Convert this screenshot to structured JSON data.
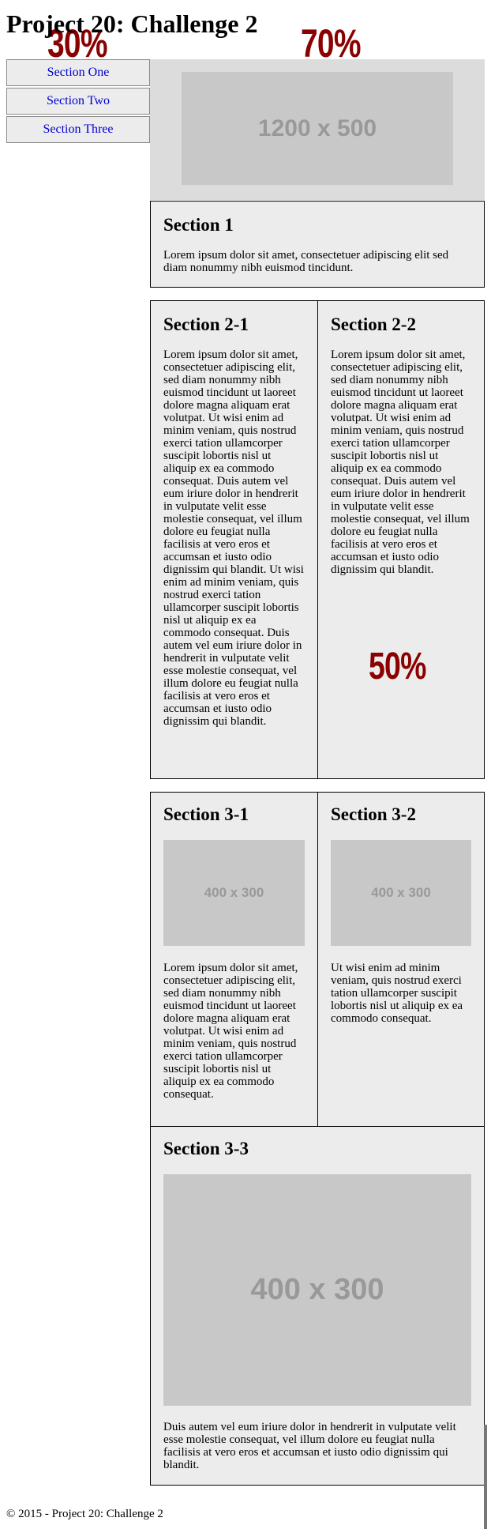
{
  "page": {
    "title": "Project 20: Challenge 2"
  },
  "overlays": {
    "left_pct": "30%",
    "right_pct": "70%",
    "middle_pct": "50%",
    "color": "#8b0000"
  },
  "nav": {
    "items": [
      {
        "label": "Section One"
      },
      {
        "label": "Section Two"
      },
      {
        "label": "Section Three"
      }
    ]
  },
  "hero": {
    "placeholder": "1200 x 500"
  },
  "section1": {
    "heading": "Section 1",
    "body": "Lorem ipsum dolor sit amet, consectetuer adipiscing elit sed diam nonummy nibh euismod tincidunt."
  },
  "section2": {
    "col1": {
      "heading": "Section 2-1",
      "body": "Lorem ipsum dolor sit amet, consectetuer adipiscing elit, sed diam nonummy nibh euismod tincidunt ut laoreet dolore magna aliquam erat volutpat. Ut wisi enim ad minim veniam, quis nostrud exerci tation ullamcorper suscipit lobortis nisl ut aliquip ex ea commodo consequat. Duis autem vel eum iriure dolor in hendrerit in vulputate velit esse molestie consequat, vel illum dolore eu feugiat nulla facilisis at vero eros et accumsan et iusto odio dignissim qui blandit. Ut wisi enim ad minim veniam, quis nostrud exerci tation ullamcorper suscipit lobortis nisl ut aliquip ex ea commodo consequat. Duis autem vel eum iriure dolor in hendrerit in vulputate velit esse molestie consequat, vel illum dolore eu feugiat nulla facilisis at vero eros et accumsan et iusto odio dignissim qui blandit."
    },
    "col2": {
      "heading": "Section 2-2",
      "body": "Lorem ipsum dolor sit amet, consectetuer adipiscing elit, sed diam nonummy nibh euismod tincidunt ut laoreet dolore magna aliquam erat volutpat. Ut wisi enim ad minim veniam, quis nostrud exerci tation ullamcorper suscipit lobortis nisl ut aliquip ex ea commodo consequat. Duis autem vel eum iriure dolor in hendrerit in vulputate velit esse molestie consequat, vel illum dolore eu feugiat nulla facilisis at vero eros et accumsan et iusto odio dignissim qui blandit."
    }
  },
  "section3": {
    "col1": {
      "heading": "Section 3-1",
      "placeholder": "400 x 300",
      "body": "Lorem ipsum dolor sit amet, consectetuer adipiscing elit, sed diam nonummy nibh euismod tincidunt ut laoreet dolore magna aliquam erat volutpat. Ut wisi enim ad minim veniam, quis nostrud exerci tation ullamcorper suscipit lobortis nisl ut aliquip ex ea commodo consequat."
    },
    "col2": {
      "heading": "Section 3-2",
      "placeholder": "400 x 300",
      "body": "Ut wisi enim ad minim veniam, quis nostrud exerci tation ullamcorper suscipit lobortis nisl ut aliquip ex ea commodo consequat."
    },
    "col3": {
      "heading": "Section 3-3",
      "placeholder": "400 x 300",
      "body": "Duis autem vel eum iriure dolor in hendrerit in vulputate velit esse molestie consequat, vel illum dolore eu feugiat nulla facilisis at vero eros et accumsan et iusto odio dignissim qui blandit."
    }
  },
  "footer": {
    "text": "© 2015 - Project 20: Challenge 2"
  }
}
